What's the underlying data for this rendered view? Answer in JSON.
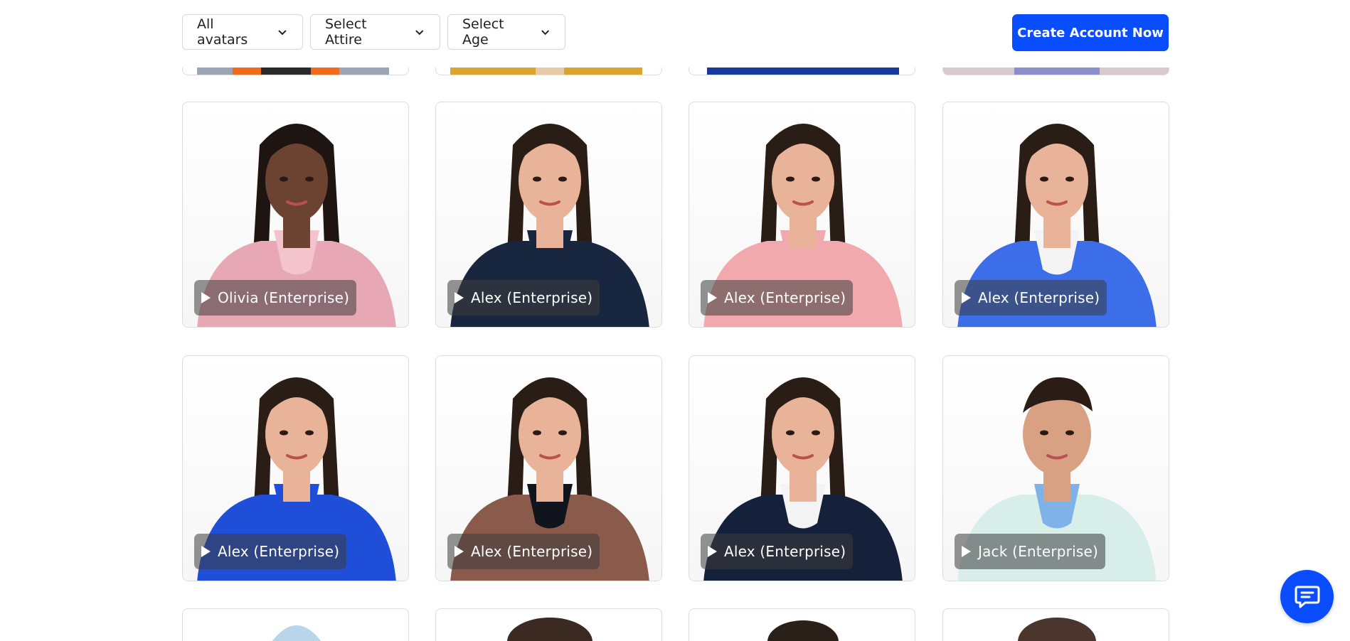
{
  "filters": {
    "all_avatars": "All avatars",
    "select_attire": "Select Attire",
    "select_age": "Select Age"
  },
  "cta": {
    "label": "Create Account Now"
  },
  "colors": {
    "accent": "#0a4dff",
    "card_border": "#dcdcdc",
    "pill_bg": "rgba(60,60,60,0.55)"
  },
  "cards": [
    {
      "name": "Olivia (Enterprise)",
      "skin": "#6b4330",
      "hair": "#1e1512",
      "top": "#e8a7b4",
      "collar": "#f3c4cc"
    },
    {
      "name": "Alex (Enterprise)",
      "skin": "#e8b399",
      "hair": "#2a1d16",
      "top": "#192640",
      "collar": "#192640"
    },
    {
      "name": "Alex (Enterprise)",
      "skin": "#e8b399",
      "hair": "#2a1d16",
      "top": "#f2a9ae",
      "collar": "#f2a9ae"
    },
    {
      "name": "Alex (Enterprise)",
      "skin": "#e8b399",
      "hair": "#2a1d16",
      "top": "#3b6ee8",
      "collar": "#f4f4f4"
    },
    {
      "name": "Alex (Enterprise)",
      "skin": "#e8b399",
      "hair": "#2a1d16",
      "top": "#1f4fd8",
      "collar": "#1f4fd8"
    },
    {
      "name": "Alex (Enterprise)",
      "skin": "#e8b399",
      "hair": "#2a1d16",
      "top": "#8a5a4a",
      "collar": "#10141c"
    },
    {
      "name": "Alex (Enterprise)",
      "skin": "#e8b399",
      "hair": "#2a1d16",
      "top": "#15203a",
      "collar": "#f4f4f4"
    },
    {
      "name": "Jack (Enterprise)",
      "skin": "#d9a184",
      "hair": "#2b1d16",
      "top": "#d8eee9",
      "collar": "#7fb2e6"
    }
  ]
}
